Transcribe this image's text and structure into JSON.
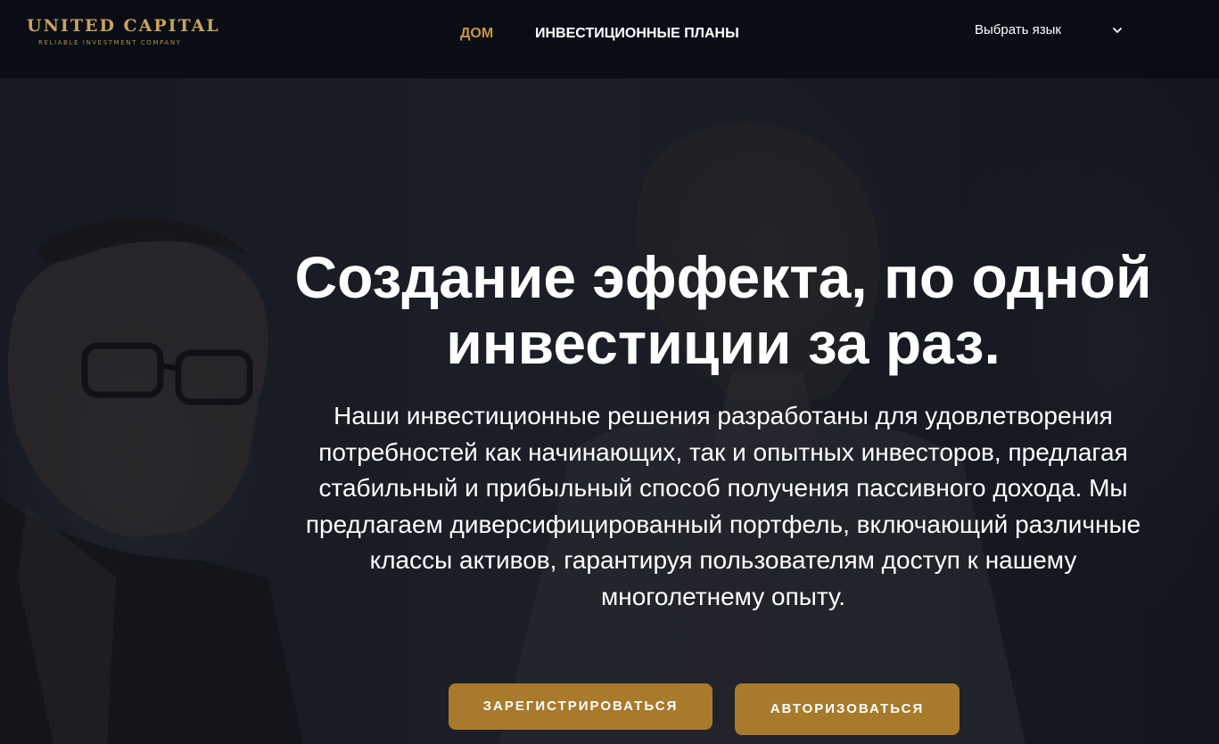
{
  "header": {
    "logo": {
      "name": "UNITED CAPITAL",
      "tagline": "RELIABLE INVESTMENT COMPANY"
    },
    "nav": [
      {
        "label": "ДОМ",
        "active": true
      },
      {
        "label": "ИНВЕСТИЦИОННЫЕ ПЛАНЫ",
        "active": false
      }
    ],
    "language_select": {
      "label": "Выбрать язык",
      "icon": "chevron-down-icon"
    }
  },
  "hero": {
    "title": "Создание эффекта, по одной инвестиции за раз.",
    "text": "Наши инвестиционные решения разработаны для удовлетворения потребностей как начинающих, так и опытных инвесторов, предлагая стабильный и прибыльный способ получения пассивного дохода. Мы предлагаем диверсифицированный портфель, включающий различные классы активов, гарантируя пользователям доступ к нашему многолетнему опыту.",
    "buttons": {
      "register": "ЗАРЕГИСТРИРОВАТЬСЯ",
      "login": "АВТОРИЗОВАТЬСЯ"
    }
  },
  "colors": {
    "accent": "#c69840",
    "button": "#a77a2c",
    "header_bg": "#0a0d15",
    "text": "#ffffff"
  }
}
